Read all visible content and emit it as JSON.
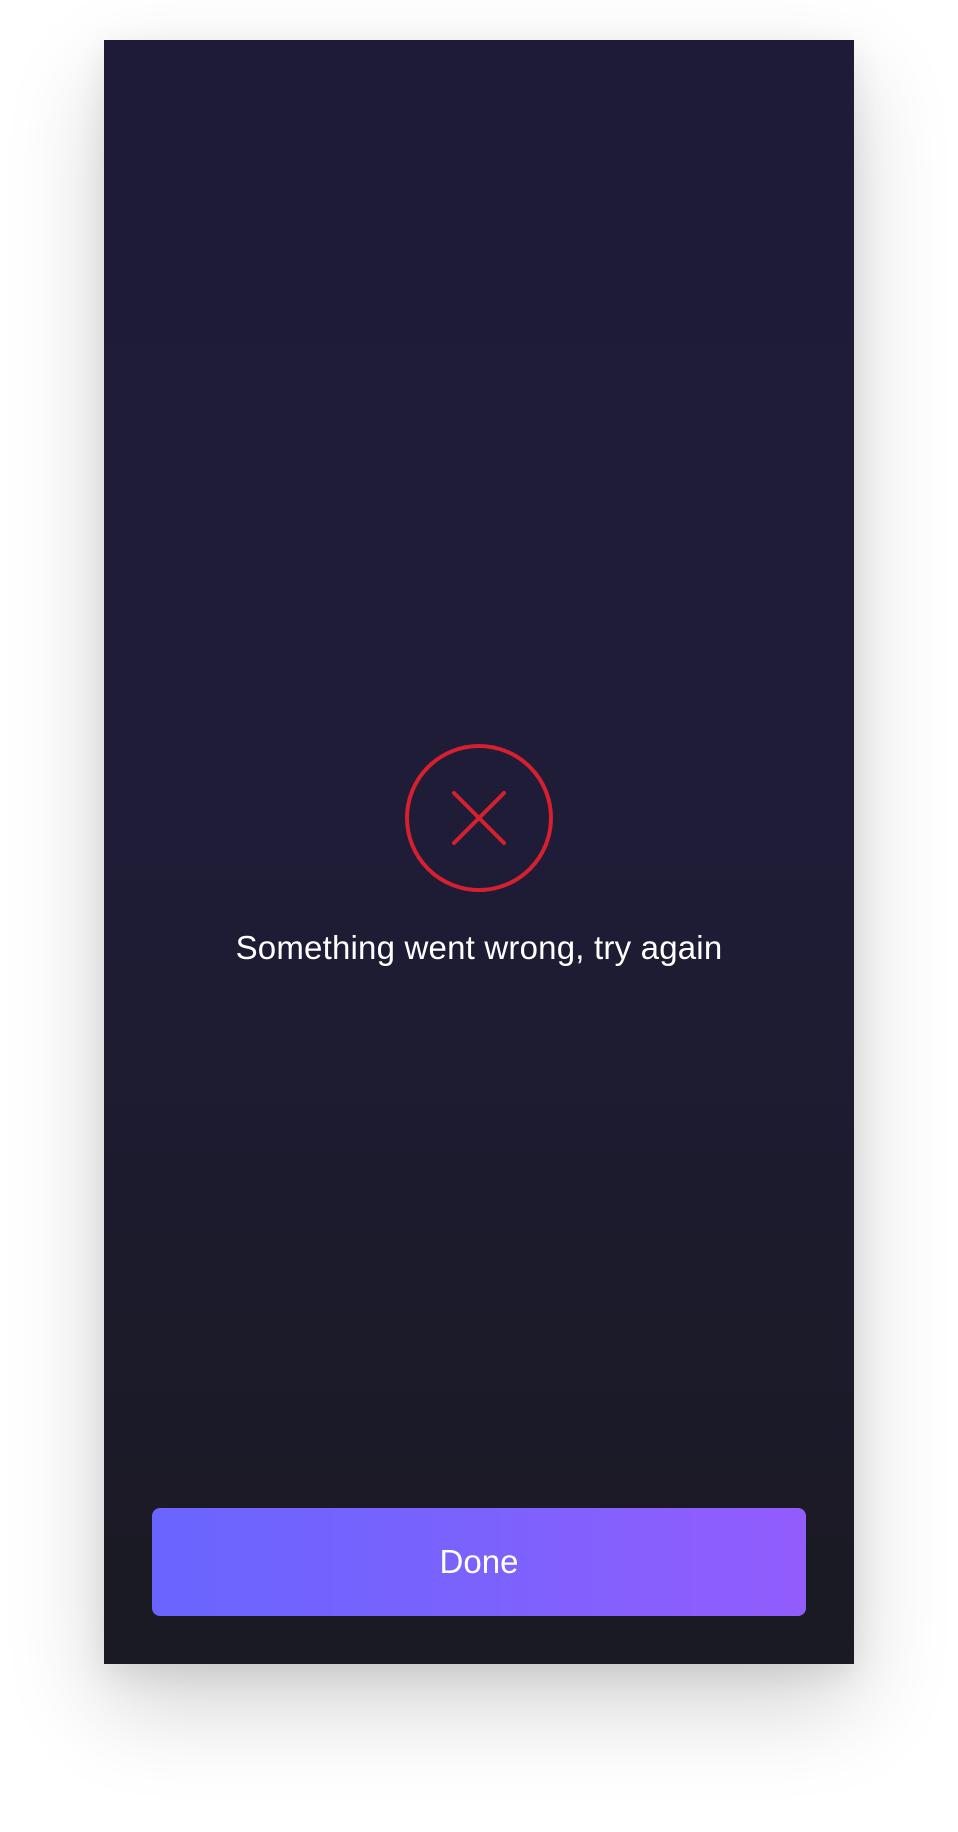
{
  "status": {
    "icon": "error-x-circle-icon",
    "icon_color": "#d6202f",
    "message": "Something went wrong, try again"
  },
  "actions": {
    "done_label": "Done",
    "done_gradient": [
      "#6a64ff",
      "#935cfd"
    ]
  },
  "theme": {
    "background_top": "#1d1b38",
    "background_bottom": "#1a1a22",
    "text_color": "#ffffff"
  }
}
